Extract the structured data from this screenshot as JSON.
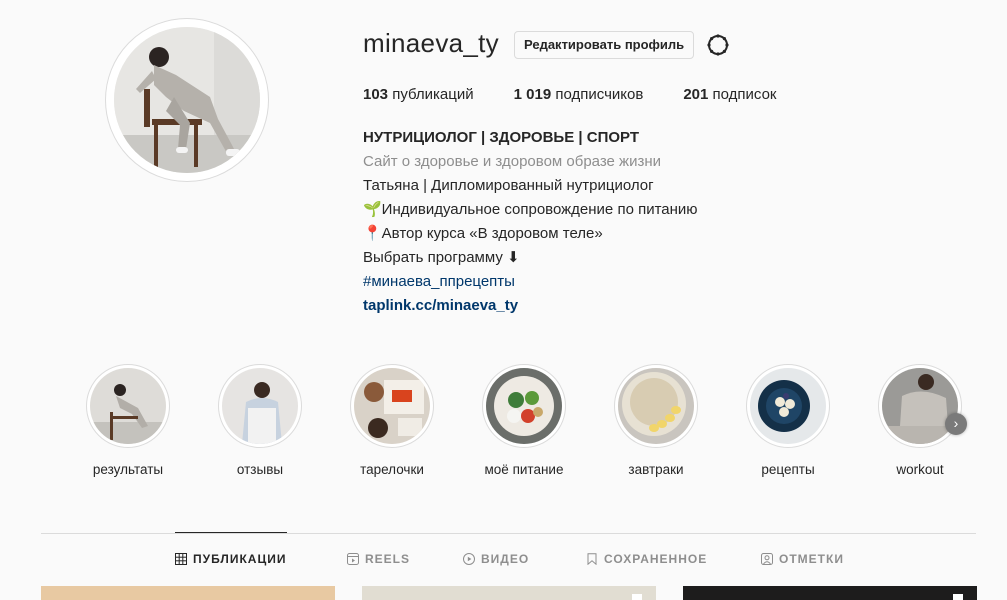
{
  "profile": {
    "username": "minaeva_ty",
    "edit_button": "Редактировать профиль",
    "settings_icon": "gear-icon"
  },
  "stats": [
    {
      "num": "103",
      "label": "публикаций"
    },
    {
      "num": "1 019",
      "label": "подписчиков"
    },
    {
      "num": "201",
      "label": "подписок"
    }
  ],
  "bio": {
    "name": "НУТРИЦИОЛОГ | ЗДОРОВЬЕ | СПОРТ",
    "category": "Сайт о здоровье и здоровом образе жизни",
    "line1": "Татьяна | Дипломированный нутрициолог",
    "line2": "🌱Индивидуальное сопровождение по питанию",
    "line3": "📍Автор курса «В здоровом теле»",
    "line4": "Выбрать программу ⬇",
    "hashtag": "#минаева_ппрецепты",
    "link": "taplink.cc/minaeva_ty"
  },
  "highlights": [
    {
      "label": "результаты"
    },
    {
      "label": "отзывы"
    },
    {
      "label": "тарелочки"
    },
    {
      "label": "моё питание"
    },
    {
      "label": "завтраки"
    },
    {
      "label": "рецепты"
    },
    {
      "label": "workout"
    }
  ],
  "tabs": [
    {
      "label": "ПУБЛИКАЦИИ",
      "icon": "grid-icon",
      "active": true
    },
    {
      "label": "REELS",
      "icon": "reels-icon",
      "active": false
    },
    {
      "label": "ВИДЕО",
      "icon": "video-icon",
      "active": false
    },
    {
      "label": "СОХРАНЕННОЕ",
      "icon": "bookmark-icon",
      "active": false
    },
    {
      "label": "ОТМЕТКИ",
      "icon": "tagged-icon",
      "active": false
    }
  ],
  "colors": {
    "background": "#fafafa",
    "text": "#262626",
    "muted": "#8e8e8e",
    "link": "#00376b",
    "border": "#dbdbdb"
  }
}
